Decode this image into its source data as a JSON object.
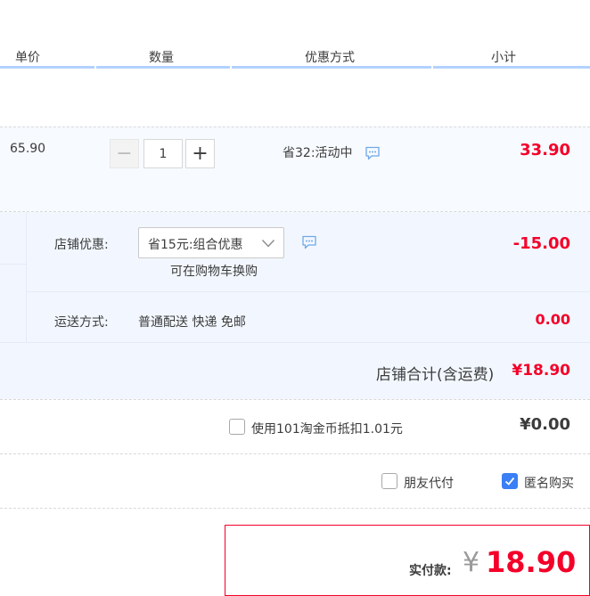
{
  "header": {
    "unit_price": "单价",
    "quantity": "数量",
    "discount": "优惠方式",
    "subtotal": "小计"
  },
  "item": {
    "price": "65.90",
    "qty_value": "1",
    "minus": "−",
    "plus": "+",
    "promo": "省32:活动中",
    "subtotal": "33.90"
  },
  "shop": {
    "discount_label": "店铺优惠:",
    "discount_selected": "省15元:组合优惠",
    "swap_text": "可在购物车换购",
    "discount_amount": "-15.00",
    "shipping_label": "运送方式:",
    "shipping_value": "普通配送 快递 免邮",
    "shipping_amount": "0.00",
    "total_label": "店铺合计(含运费)",
    "total_value": "¥18.90"
  },
  "coins": {
    "label": "使用101淘金币抵扣1.01元",
    "amount": "¥0.00"
  },
  "options": {
    "friend_pay": "朋友代付",
    "anonymous": "匿名购买",
    "anonymous_checked": true
  },
  "total": {
    "label": "实付款:",
    "currency": "¥",
    "value": "18.90"
  },
  "colors": {
    "accent_red": "#f40029",
    "header_line": "#b2d1ff",
    "shop_bg": "#f2f7ff",
    "checkbox_blue": "#3a7ff5"
  }
}
